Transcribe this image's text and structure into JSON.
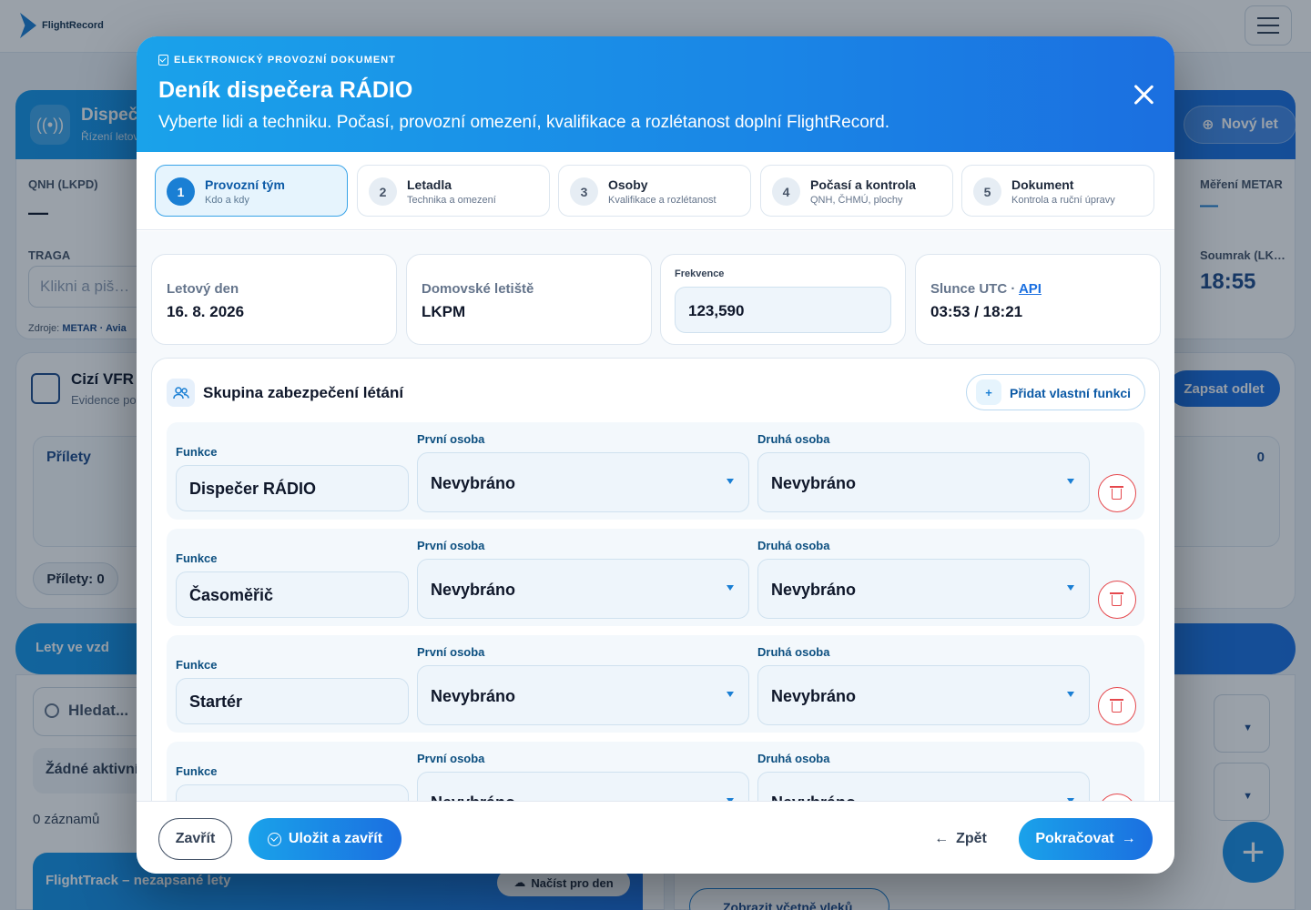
{
  "app": {
    "logo_text": "FlightRecord"
  },
  "background": {
    "hero_title": "Dispeč",
    "hero_sub": "Řízení letov",
    "new_flight_label": "Nový let",
    "qnh_label": "QNH (LKPD)",
    "qnh_value": "—",
    "metar_label": "Měření METAR",
    "metar_value": "—",
    "traga_label": "TRAGA",
    "traga_placeholder": "Klikni a piš…",
    "soumrak_label": "Soumrak (LK…",
    "soumrak_value": "18:55",
    "zdroje_label": "Zdroje:",
    "zdroje_value": "METAR · Avia",
    "vfr_title": "Cizí VFR",
    "vfr_sub": "Evidence po",
    "odlet_label": "Zapsat odlet",
    "prilety_title": "Přílety",
    "prilety_count": "0",
    "prilety_pill": "Přílety: 0",
    "lety_title": "Lety ve vzd",
    "search_placeholder": "Hledat...",
    "zadne_label": "Žádné aktivní",
    "zaznamu": "0 záznamů",
    "ftrack_title": "FlightTrack – nezapsané lety",
    "nacist_label": "Načíst pro den",
    "vleky_label": "Zobrazit včetně vleků"
  },
  "modal": {
    "eyebrow": "ELEKTRONICKÝ PROVOZNÍ DOKUMENT",
    "title": "Deník dispečera RÁDIO",
    "subtitle": "Vyberte lidi a techniku. Počasí, provozní omezení, kvalifikace a rozlétanost doplní FlightRecord.",
    "steps": [
      {
        "num": "1",
        "title": "Provozní tým",
        "sub": "Kdo a kdy",
        "active": true
      },
      {
        "num": "2",
        "title": "Letadla",
        "sub": "Technika a omezení",
        "active": false
      },
      {
        "num": "3",
        "title": "Osoby",
        "sub": "Kvalifikace a rozlétanost",
        "active": false
      },
      {
        "num": "4",
        "title": "Počasí a kontrola",
        "sub": "QNH, ČHMÚ, plochy",
        "active": false
      },
      {
        "num": "5",
        "title": "Dokument",
        "sub": "Kontrola a ruční úpravy",
        "active": false
      }
    ],
    "info": {
      "day_label": "Letový den",
      "day_value": "16. 8. 2026",
      "airport_label": "Domovské letiště",
      "airport_value": "LKPM",
      "freq_label": "Frekvence",
      "freq_value": "123,590",
      "sun_label": "Slunce UTC · ",
      "sun_api": "API",
      "sun_value": "03:53 / 18:21"
    },
    "group": {
      "title": "Skupina zabezpečení létání",
      "add_label": "Přidat vlastní funkci",
      "func_label": "Funkce",
      "first_label": "První osoba",
      "second_label": "Druhá osoba",
      "rows": [
        {
          "func": "Dispečer RÁDIO",
          "first": "Nevybráno",
          "second": "Nevybráno"
        },
        {
          "func": "Časoměřič",
          "first": "Nevybráno",
          "second": "Nevybráno"
        },
        {
          "func": "Startér",
          "first": "Nevybráno",
          "second": "Nevybráno"
        },
        {
          "func": "",
          "first": "Nevybráno",
          "second": "Nevybráno"
        }
      ]
    },
    "footer": {
      "close_label": "Zavřít",
      "save_label": "Uložit a zavřít",
      "back_label": "Zpět",
      "next_label": "Pokračovat"
    }
  },
  "colors": {
    "accent": "#1a7fd4",
    "header_gradient_start": "#1aa2ea",
    "header_gradient_end": "#1b6fe0",
    "danger": "#e5484d"
  }
}
